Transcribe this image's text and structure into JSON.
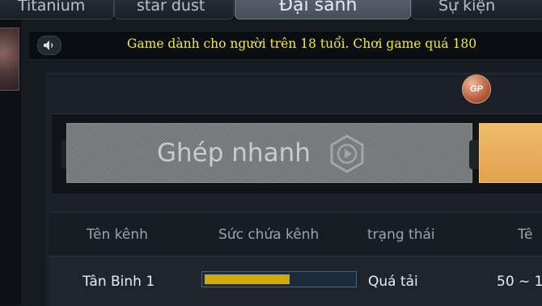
{
  "tabs": [
    {
      "label": "Titanium",
      "active": false
    },
    {
      "label": "star dust",
      "active": false
    },
    {
      "label": "Đại sảnh",
      "active": true
    },
    {
      "label": "Sự kiện",
      "active": false
    }
  ],
  "announcement": {
    "icon": "speaker-icon",
    "text": "Game dành cho người trên 18 tuổi. Chơi game quá 180"
  },
  "gp_badge": {
    "label": "GP",
    "icon": "gp-coin-icon"
  },
  "quick_join": {
    "label": "Ghép nhanh",
    "icon": "play-hexagon-icon"
  },
  "channel_table": {
    "headers": [
      "Tên kênh",
      "Sức chứa kênh",
      "trạng thái",
      "Tê"
    ],
    "rows": [
      {
        "name": "Tân Binh 1",
        "capacity_fraction": 0.57,
        "status": "Quá tải",
        "range": "50 ~ 1"
      }
    ]
  },
  "colors": {
    "announcement_text": "#f6ea3c",
    "capacity_bar_fill": "#cfa90f",
    "orange_button": "#e8ae5c",
    "active_tab": "#545e6a"
  }
}
